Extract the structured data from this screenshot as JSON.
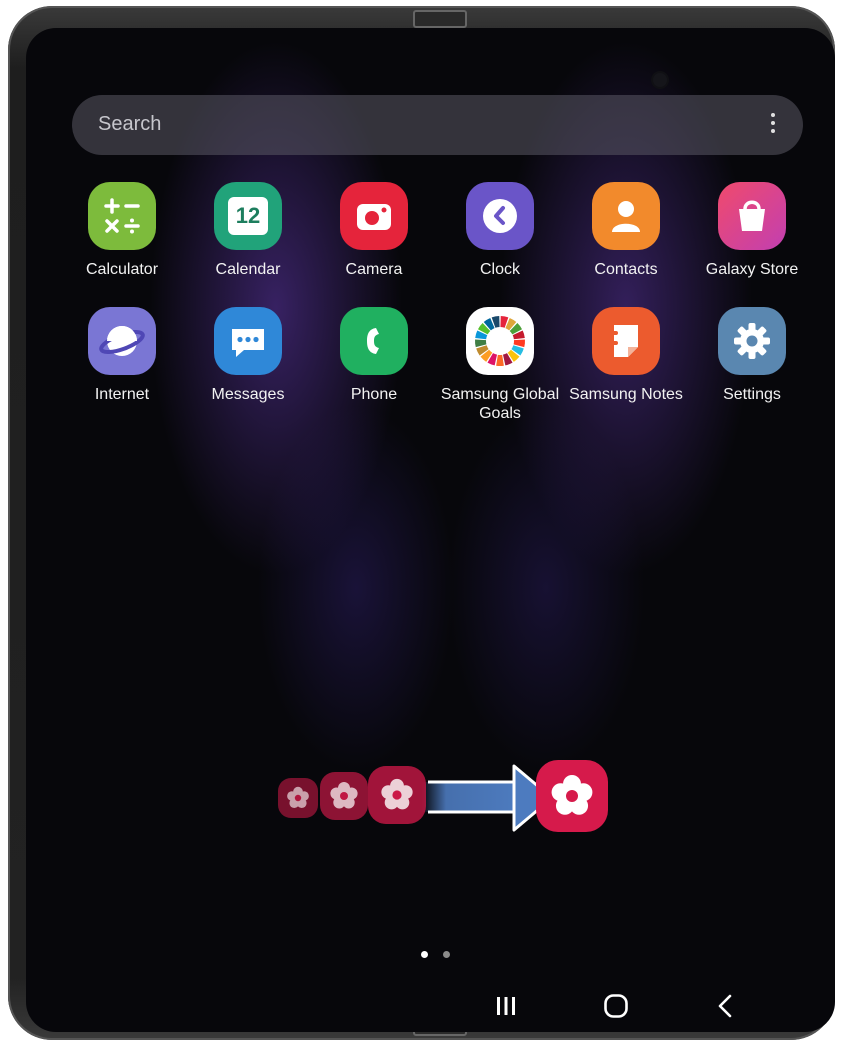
{
  "search": {
    "placeholder": "Search",
    "more_icon": "more-vertical-icon"
  },
  "apps": [
    {
      "label": "Calculator",
      "icon": "calculator-icon",
      "color": "#7dbb3c"
    },
    {
      "label": "Calendar",
      "icon": "calendar-icon",
      "color": "#21a37a",
      "badge": "12"
    },
    {
      "label": "Camera",
      "icon": "camera-icon",
      "color": "#e5243b"
    },
    {
      "label": "Clock",
      "icon": "clock-icon",
      "color": "#6a55c8"
    },
    {
      "label": "Contacts",
      "icon": "contacts-icon",
      "color": "#f28a2c"
    },
    {
      "label": "Galaxy Store",
      "icon": "shopping-bag-icon",
      "color": "#e64a8a"
    },
    {
      "label": "Internet",
      "icon": "internet-planet-icon",
      "color": "#7a76d4"
    },
    {
      "label": "Messages",
      "icon": "messages-icon",
      "color": "#2f88d8"
    },
    {
      "label": "Phone",
      "icon": "phone-icon",
      "color": "#20b060"
    },
    {
      "label": "Samsung Global Goals",
      "icon": "global-goals-icon",
      "color": "#ffffff"
    },
    {
      "label": "Samsung Notes",
      "icon": "notes-icon",
      "color": "#ec5b2e"
    },
    {
      "label": "Settings",
      "icon": "gear-icon",
      "color": "#5a87b0"
    }
  ],
  "drag_hint": {
    "icon": "bixby-routines-flower-icon",
    "color": "#d61a4b",
    "arrow_color": "#4d7bbf"
  },
  "page_indicator": {
    "pages": 2,
    "current": 1
  },
  "navigation": [
    {
      "name": "recents-button",
      "icon": "recents-icon"
    },
    {
      "name": "home-button",
      "icon": "home-icon"
    },
    {
      "name": "back-button",
      "icon": "back-chevron-icon"
    }
  ]
}
